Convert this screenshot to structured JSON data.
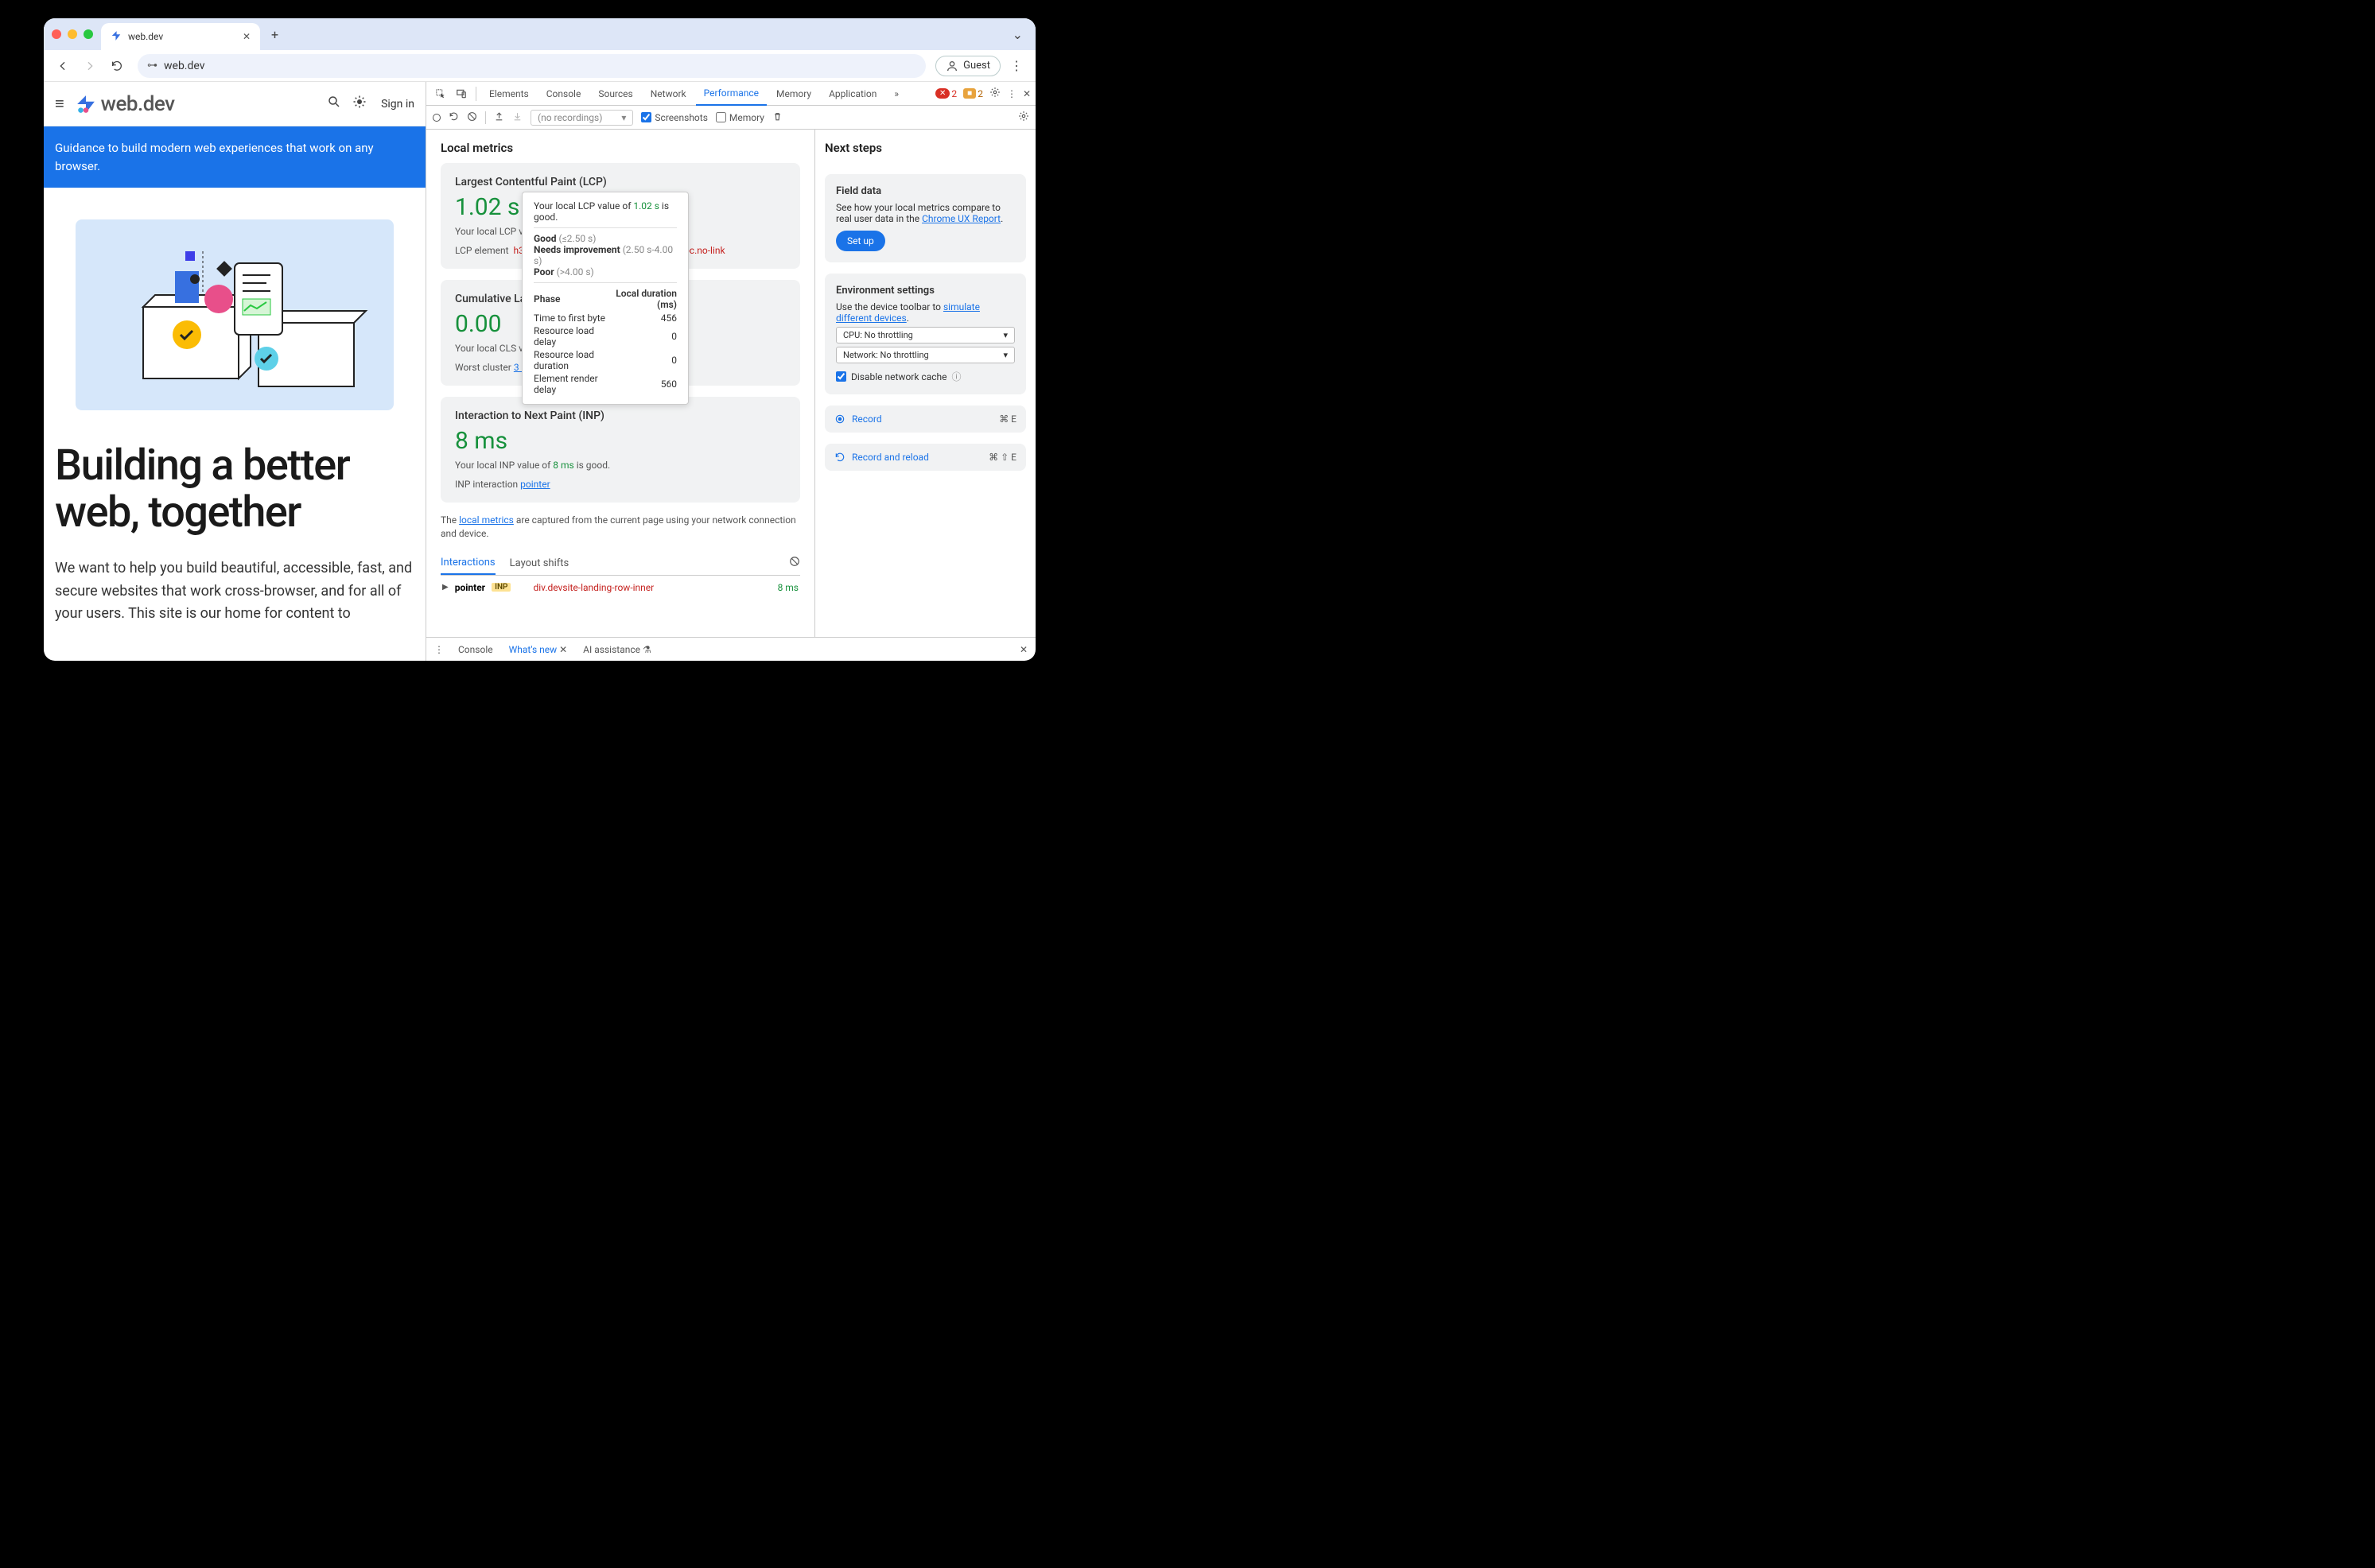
{
  "browser": {
    "tab_title": "web.dev",
    "url": "web.dev",
    "guest_label": "Guest"
  },
  "page": {
    "logo_text": "web.dev",
    "signin": "Sign in",
    "banner": "Guidance to build modern web experiences that work on any browser.",
    "hero_title": "Building a better web, together",
    "hero_body": "We want to help you build beautiful, accessible, fast, and secure websites that work cross-browser, and for all of your users. This site is our home for content to"
  },
  "devtools": {
    "tabs": [
      "Elements",
      "Console",
      "Sources",
      "Network",
      "Performance",
      "Memory",
      "Application"
    ],
    "active_tab": "Performance",
    "errors": "2",
    "warnings": "2",
    "toolbar": {
      "no_recordings": "(no recordings)",
      "screenshots": "Screenshots",
      "memory": "Memory"
    },
    "local_metrics_title": "Local metrics",
    "lcp": {
      "title": "Largest Contentful Paint (LCP)",
      "value": "1.02 s",
      "desc_prefix": "Your local LCP valu",
      "element_label": "LCP element",
      "element_sel_prefix": "h3#b",
      "element_sel_suffix": ".toc.no-link"
    },
    "tooltip": {
      "line1_pre": "Your local LCP value of ",
      "line1_val": "1.02 s",
      "line1_post": " is good.",
      "good": "Good",
      "good_range": "(≤2.50 s)",
      "ni": "Needs improvement",
      "ni_range": "(2.50 s-4.00 s)",
      "poor": "Poor",
      "poor_range": "(>4.00 s)",
      "phase_h": "Phase",
      "dur_h": "Local duration (ms)",
      "rows": [
        {
          "label": "Time to first byte",
          "val": "456"
        },
        {
          "label": "Resource load delay",
          "val": "0"
        },
        {
          "label": "Resource load duration",
          "val": "0"
        },
        {
          "label": "Element render delay",
          "val": "560"
        }
      ]
    },
    "cls": {
      "title": "Cumulative Layo",
      "value": "0.00",
      "desc": "Your local CLS valu",
      "worst_label": "Worst cluster",
      "worst_link": "3 shifts"
    },
    "inp": {
      "title": "Interaction to Next Paint (INP)",
      "value": "8 ms",
      "desc_pre": "Your local INP value of ",
      "desc_val": "8 ms",
      "desc_post": " is good.",
      "interaction_label": "INP interaction",
      "interaction_link": "pointer"
    },
    "caption_pre": "The ",
    "caption_link": "local metrics",
    "caption_post": " are captured from the current page using your network connection and device.",
    "subtabs": {
      "interactions": "Interactions",
      "layout_shifts": "Layout shifts"
    },
    "interaction_row": {
      "name": "pointer",
      "tag": "INP",
      "sel": "div.devsite-landing-row-inner",
      "ms": "8 ms"
    },
    "next_steps_title": "Next steps",
    "field_data": {
      "title": "Field data",
      "body_pre": "See how your local metrics compare to real user data in the ",
      "link": "Chrome UX Report",
      "setup": "Set up"
    },
    "env": {
      "title": "Environment settings",
      "body_pre": "Use the device toolbar to ",
      "link": "simulate different devices",
      "cpu": "CPU: No throttling",
      "net": "Network: No throttling",
      "disable_cache": "Disable network cache"
    },
    "record": {
      "label": "Record",
      "shortcut": "⌘ E"
    },
    "record_reload": {
      "label": "Record and reload",
      "shortcut": "⌘ ⇧ E"
    },
    "drawer": {
      "console": "Console",
      "whatsnew": "What's new",
      "ai": "AI assistance"
    }
  }
}
